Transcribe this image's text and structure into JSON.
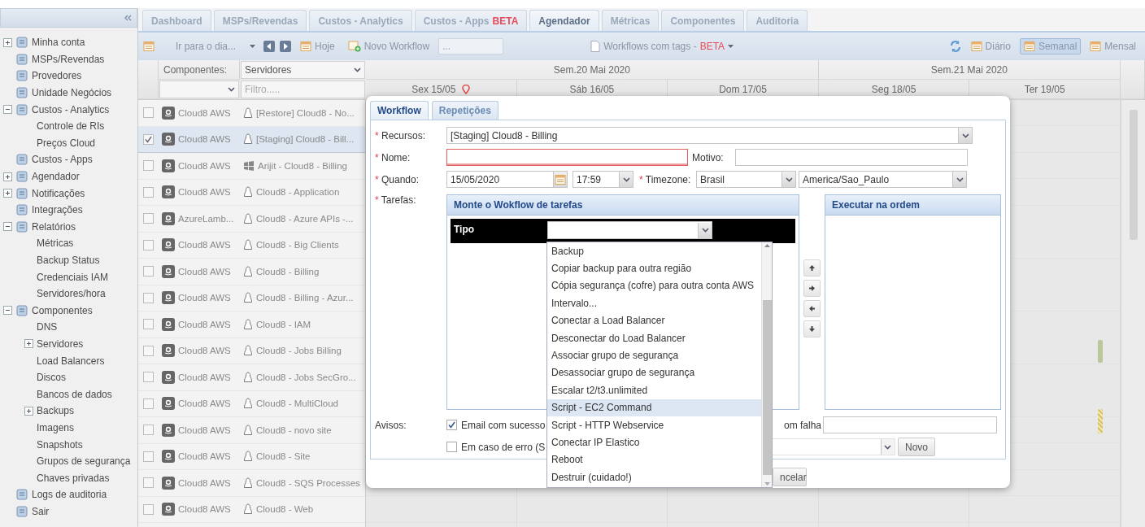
{
  "sidebar": {
    "items": [
      {
        "label": "Minha conta",
        "expanded": false
      },
      {
        "label": "MSPs/Revendas"
      },
      {
        "label": "Provedores"
      },
      {
        "label": "Unidade Negócios"
      },
      {
        "label": "Custos - Analytics",
        "expanded": true,
        "children": [
          {
            "label": "Controle de RIs"
          },
          {
            "label": "Preços Cloud"
          }
        ]
      },
      {
        "label": "Custos - Apps"
      },
      {
        "label": "Agendador",
        "expanded": false
      },
      {
        "label": "Notificações",
        "expanded": false
      },
      {
        "label": "Integrações"
      },
      {
        "label": "Relatórios",
        "expanded": true,
        "children": [
          {
            "label": "Métricas"
          },
          {
            "label": "Backup Status"
          },
          {
            "label": "Credenciais IAM"
          },
          {
            "label": "Servidores/hora"
          }
        ]
      },
      {
        "label": "Componentes",
        "expanded": true,
        "children": [
          {
            "label": "DNS"
          },
          {
            "label": "Servidores",
            "expanded": false
          },
          {
            "label": "Load Balancers"
          },
          {
            "label": "Discos"
          },
          {
            "label": "Bancos de dados"
          },
          {
            "label": "Backups",
            "expanded": false
          },
          {
            "label": "Imagens"
          },
          {
            "label": "Snapshots"
          },
          {
            "label": "Grupos de segurança"
          },
          {
            "label": "Chaves privadas"
          }
        ]
      },
      {
        "label": "Logs de auditoria"
      },
      {
        "label": "Sair"
      }
    ]
  },
  "tabs": [
    {
      "label": "Dashboard",
      "selected": false
    },
    {
      "label": "MSPs/Revendas",
      "selected": false
    },
    {
      "label": "Custos - Analytics",
      "selected": false
    },
    {
      "label": "Custos - Apps",
      "badge": "BETA",
      "selected": false
    },
    {
      "label": "Agendador",
      "selected": true
    },
    {
      "label": "Métricas",
      "selected": false
    },
    {
      "label": "Componentes",
      "selected": false
    },
    {
      "label": "Auditoria",
      "selected": false
    }
  ],
  "toolbar": {
    "goto_placeholder": "Ir para o dia...",
    "today": "Hoje",
    "new_workflow": "Novo Workflow",
    "search_placeholder": "...",
    "tags_filter": {
      "label": "Workflows com tags - ",
      "badge": "BETA"
    },
    "views": [
      {
        "label": "Diário",
        "selected": false
      },
      {
        "label": "Semanal",
        "selected": true
      },
      {
        "label": "Mensal",
        "selected": false
      }
    ]
  },
  "grid": {
    "filter_label": "Componentes:",
    "component_select": "Servidores",
    "filter_placeholder": "Filtro.....",
    "weeks": [
      {
        "label": "Sem.20 Mai 2020",
        "days": [
          {
            "label": "Sex 15/05",
            "today": true
          },
          {
            "label": "Sáb 16/05",
            "today": false
          },
          {
            "label": "Dom 17/05",
            "today": false
          }
        ]
      },
      {
        "label": "Sem.21 Mai 2020",
        "days": [
          {
            "label": "Seg 18/05",
            "today": false
          },
          {
            "label": "Ter 19/05",
            "today": false
          }
        ]
      }
    ],
    "rows": [
      {
        "checked": false,
        "selected": false,
        "account": "Cloud8 AWS",
        "server": "[Restore] Cloud8 - No...",
        "kind": "linux"
      },
      {
        "checked": true,
        "selected": true,
        "account": "Cloud8 AWS",
        "server": "[Staging] Cloud8 - Bill...",
        "kind": "linux"
      },
      {
        "checked": false,
        "selected": false,
        "account": "Cloud8 AWS",
        "server": "Arijit - Cloud8 - Billing",
        "kind": "windows"
      },
      {
        "checked": false,
        "selected": false,
        "account": "Cloud8 AWS",
        "server": "Cloud8 - Application",
        "kind": "linux"
      },
      {
        "checked": false,
        "selected": false,
        "account": "AzureLamb...",
        "server": "Cloud8 - Azure APIs -...",
        "kind": "linux"
      },
      {
        "checked": false,
        "selected": false,
        "account": "Cloud8 AWS",
        "server": "Cloud8 - Big Clients",
        "kind": "linux"
      },
      {
        "checked": false,
        "selected": false,
        "account": "Cloud8 AWS",
        "server": "Cloud8 - Billing",
        "kind": "linux"
      },
      {
        "checked": false,
        "selected": false,
        "account": "Cloud8 AWS",
        "server": "Cloud8 - Billing - Azur...",
        "kind": "linux"
      },
      {
        "checked": false,
        "selected": false,
        "account": "Cloud8 AWS",
        "server": "Cloud8 - IAM",
        "kind": "linux"
      },
      {
        "checked": false,
        "selected": false,
        "account": "Cloud8 AWS",
        "server": "Cloud8 - Jobs Billing",
        "kind": "linux"
      },
      {
        "checked": false,
        "selected": false,
        "account": "Cloud8 AWS",
        "server": "Cloud8 - Jobs SecGro...",
        "kind": "linux"
      },
      {
        "checked": false,
        "selected": false,
        "account": "Cloud8 AWS",
        "server": "Cloud8 - MultiCloud",
        "kind": "linux"
      },
      {
        "checked": false,
        "selected": false,
        "account": "Cloud8 AWS",
        "server": "Cloud8 - novo site",
        "kind": "linux"
      },
      {
        "checked": false,
        "selected": false,
        "account": "Cloud8 AWS",
        "server": "Cloud8 - Site",
        "kind": "linux"
      },
      {
        "checked": false,
        "selected": false,
        "account": "Cloud8 AWS",
        "server": "Cloud8 - SQS Processes",
        "kind": "linux"
      },
      {
        "checked": false,
        "selected": false,
        "account": "Cloud8 AWS",
        "server": "Cloud8 - Web",
        "kind": "linux"
      }
    ]
  },
  "dialog": {
    "tabs": [
      {
        "label": "Workflow",
        "selected": true
      },
      {
        "label": "Repetições",
        "selected": false
      }
    ],
    "resources": {
      "marker": "*",
      "label": "Recursos:",
      "value": "[Staging] Cloud8 - Billing"
    },
    "name": {
      "marker": "*",
      "label": "Nome:",
      "invalid": true
    },
    "reason": {
      "label": "Motivo:"
    },
    "when": {
      "marker": "*",
      "label": "Quando:",
      "date": "15/05/2020",
      "time": "17:59"
    },
    "timezone": {
      "marker": "*",
      "label": "Timezone:",
      "region": "Brasil",
      "zone": "America/Sao_Paulo"
    },
    "tasks": {
      "marker": "*",
      "label": "Tarefas:",
      "builder_title": "Monte o Wokflow de tarefas",
      "type_header": "Tipo",
      "order_title": "Executar na ordem"
    },
    "notices": {
      "label": "Avisos:",
      "options": [
        {
          "label": "Email com sucesso",
          "checked": true
        },
        {
          "label": "Em caso de erro (S",
          "checked": false
        }
      ],
      "fail_label": "om falha",
      "new_button": "Novo"
    },
    "cancel_button": "ncelar",
    "type_options": [
      {
        "label": "Backup",
        "selected": false
      },
      {
        "label": "Copiar backup para outra região",
        "selected": false
      },
      {
        "label": "Cópia segurança (cofre) para outra conta AWS",
        "selected": false
      },
      {
        "label": "Intervalo...",
        "selected": false
      },
      {
        "label": "Conectar a Load Balancer",
        "selected": false
      },
      {
        "label": "Desconectar do Load Balancer",
        "selected": false
      },
      {
        "label": "Associar grupo de segurança",
        "selected": false
      },
      {
        "label": "Desassociar grupo de segurança",
        "selected": false
      },
      {
        "label": "Escalar t2/t3.unlimited",
        "selected": false
      },
      {
        "label": "Script - EC2 Command",
        "selected": true
      },
      {
        "label": "Script - HTTP Webservice",
        "selected": false
      },
      {
        "label": "Conectar IP Elastico",
        "selected": false
      },
      {
        "label": "Reboot",
        "selected": false
      },
      {
        "label": "Destruir (cuidado!)",
        "selected": false
      }
    ]
  }
}
